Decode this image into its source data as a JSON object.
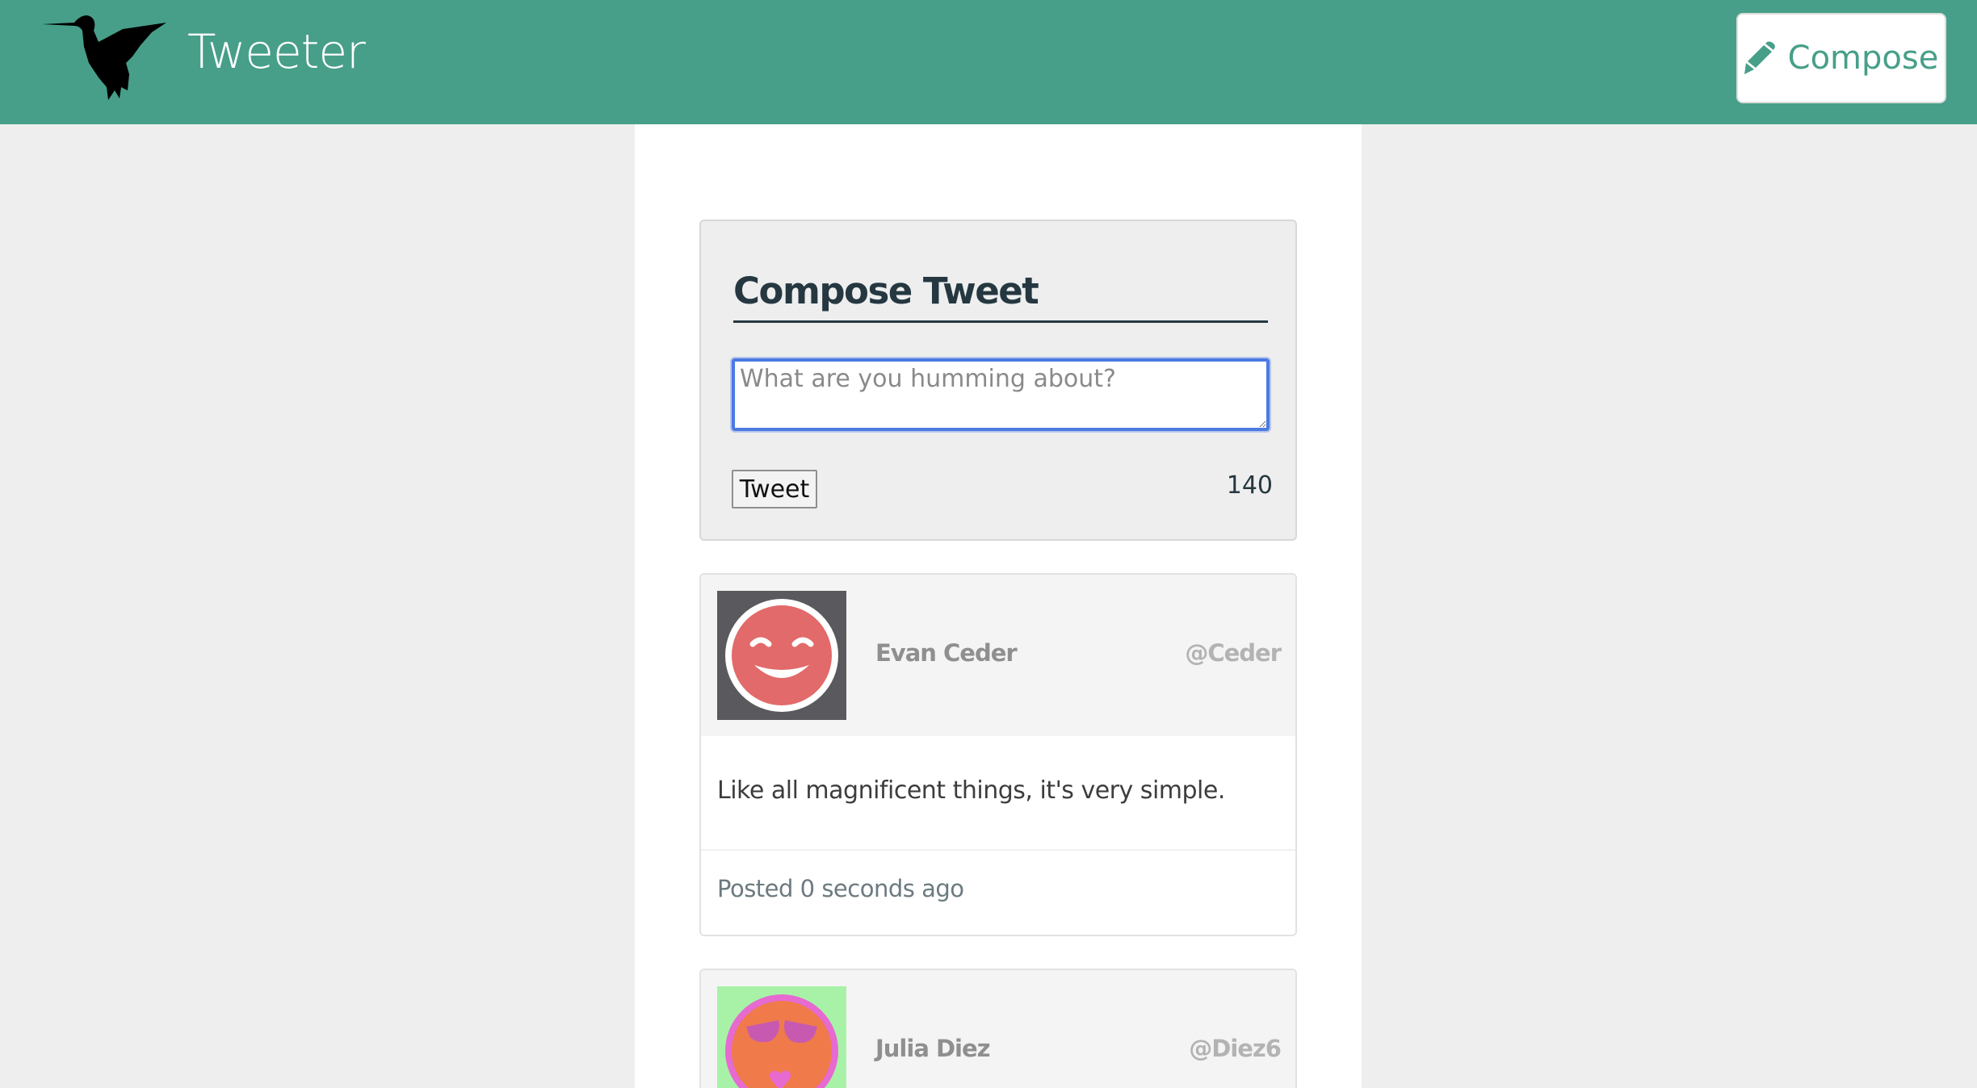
{
  "app": {
    "brand": "Tweeter"
  },
  "nav": {
    "compose_label": "Compose"
  },
  "compose": {
    "title": "Compose Tweet",
    "placeholder": "What are you humming about?",
    "value": "",
    "button_label": "Tweet",
    "char_counter": "140"
  },
  "tweets": [
    {
      "name": "Evan Ceder",
      "handle": "@Ceder",
      "text": "Like all magnificent things, it's very simple.",
      "posted": "Posted 0 seconds ago",
      "avatar_bg": "#5a5a5e",
      "avatar_face": "#e26a6a"
    },
    {
      "name": "Julia Diez",
      "handle": "@Diez6",
      "text": "",
      "posted": "",
      "avatar_bg": "#a8f2a8",
      "avatar_face": "#f07a4a"
    }
  ],
  "colors": {
    "navbar": "#479f89",
    "accent": "#479f89",
    "title": "#253841",
    "focus_ring": "#4c7ae3"
  },
  "icons": {
    "logo": "hummingbird-icon",
    "compose": "pencil-icon"
  }
}
